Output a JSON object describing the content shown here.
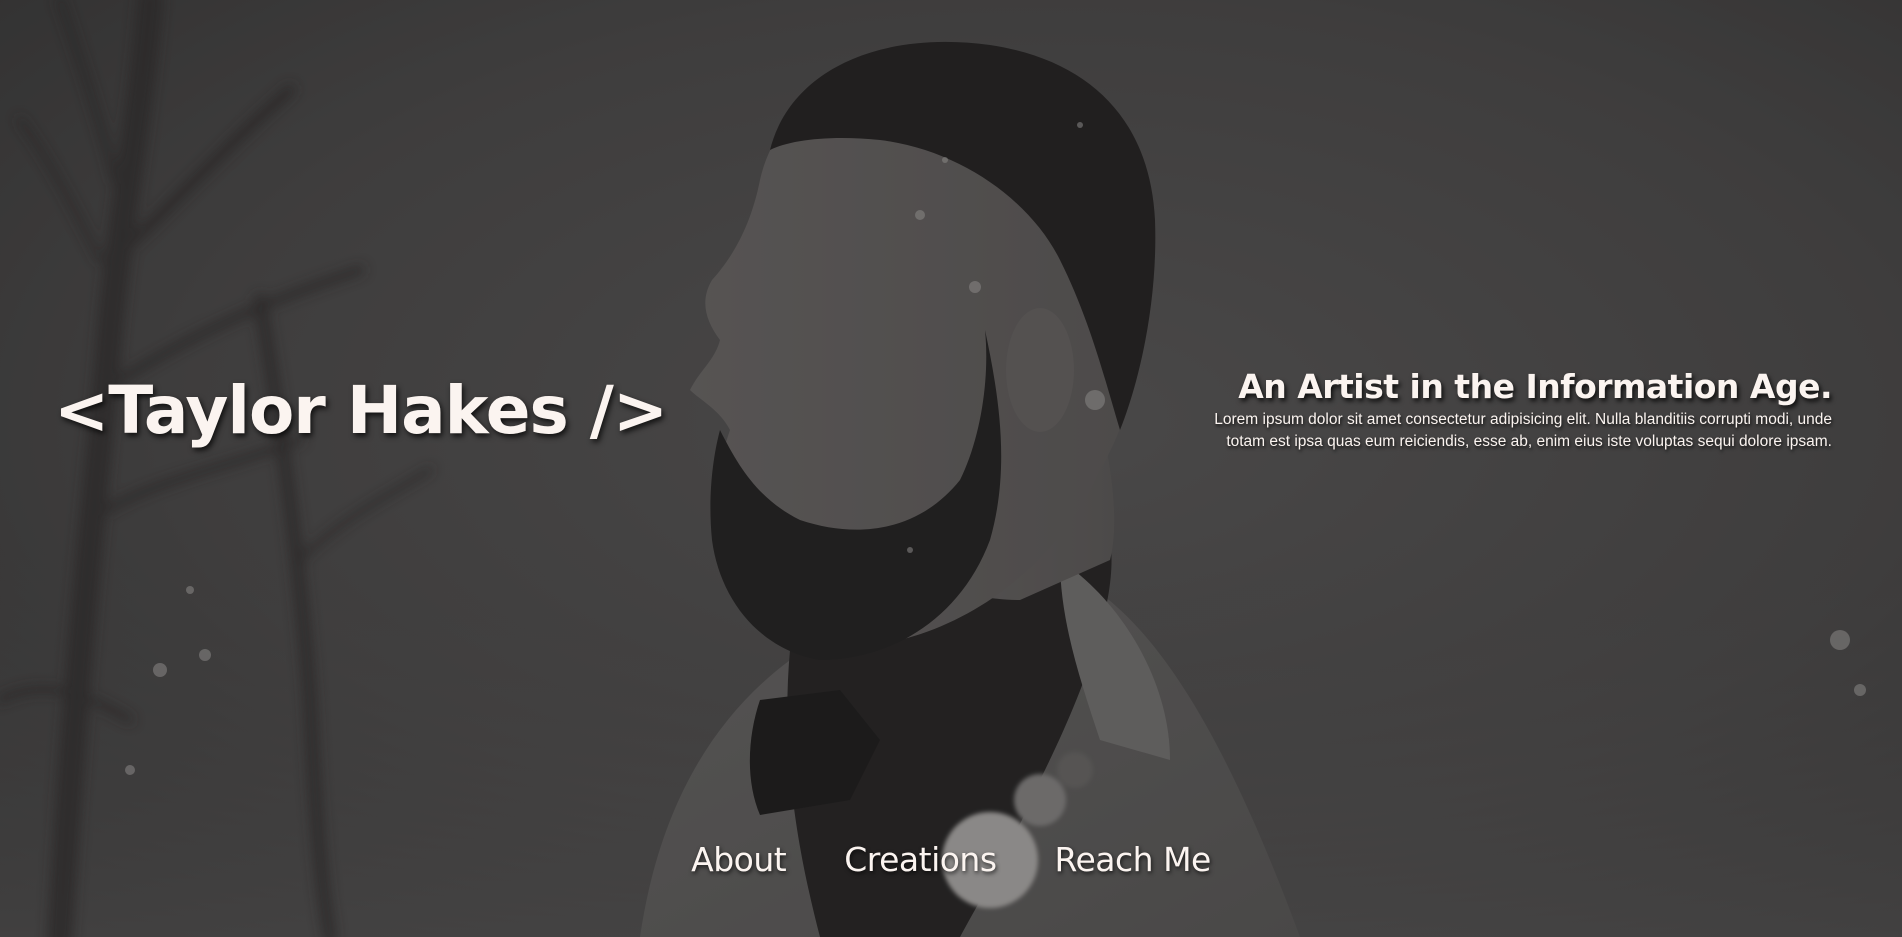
{
  "site": {
    "title": "<Taylor Hakes />"
  },
  "hero": {
    "background_image": "black-and-white-portrait-of-bearded-man-in-snow",
    "overlay_color": "#3a3a3a",
    "text_color": "#fbf4f0",
    "tagline": "An Artist in the Information Age.",
    "description": "Lorem ipsum dolor sit amet consectetur adipisicing elit. Nulla blanditiis corrupti modi, unde totam est ipsa quas eum reiciendis, esse ab, enim eius iste voluptas sequi dolore ipsam."
  },
  "nav": {
    "items": [
      {
        "label": "About"
      },
      {
        "label": "Creations"
      },
      {
        "label": "Reach Me"
      }
    ]
  }
}
